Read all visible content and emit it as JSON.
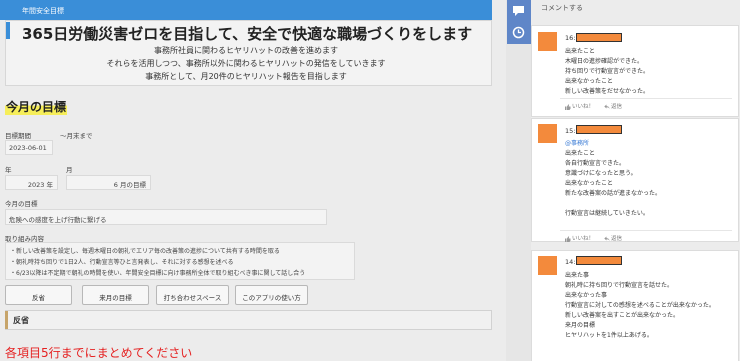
{
  "app": {
    "tab_title": "年間安全目標"
  },
  "annual_goal": {
    "headline": "365日労働災害ゼロを目指して、安全で快適な職場づくりをします",
    "lines": [
      "事務所社員に関わるヒヤリハットの改善を進めます",
      "それらを活用しつつ、事務所以外に関わるヒヤリハットの発信をしていきます",
      "事務所として、月20件のヒヤリハット報告を目指します"
    ]
  },
  "monthly": {
    "heading": "今月の目標",
    "period_label": "目標期間",
    "period_start": "2023-06-01",
    "period_end_label": "〜月末まで",
    "year_label": "年",
    "month_label": "月",
    "year_value": "2023 年",
    "month_value": "6 月の目標",
    "goal_label": "今月の目標",
    "goal_value": "危険への感度を上げ行動に繋げる",
    "actions_label": "取り組み内容",
    "actions": [
      "・新しい改善策を設定し、毎週木曜日の朝礼でエリア毎の改善策の進捗について共有する時間を取る",
      "・朝礼時持ち回りで1日2人、行動宣言等ひと言発表し、それに対する感想を述べる",
      "・6/23以降は不定期で朝礼の時間を使い、年間安全目標に向け事務所全体で取り組むべき事に関して話し合う"
    ]
  },
  "tabs": [
    "反省",
    "来月の目標",
    "打ち合わせスペース",
    "このアプリの使い方"
  ],
  "reflection": {
    "label": "反省",
    "instruction": "各項目5行までにまとめてください"
  },
  "comments_panel": {
    "header": "コメントする",
    "like_label": "いいね！",
    "reply_label": "返信",
    "comments": [
      {
        "number": "16:",
        "lines": [
          "出来たこと",
          "木曜日の進捗確認ができた。",
          "持ち回りで行動宣言ができた。",
          "出来なかったこと",
          "新しい改善策をだせなかった。"
        ]
      },
      {
        "number": "15:",
        "mention": "@事務所",
        "lines": [
          "出来たこと",
          "各自行動宣言できた。",
          "意識づけになったと思う。",
          "出来なかったこと",
          "新たな改善案の話が進まなかった。",
          "",
          "行動宣言は継続していきたい。"
        ]
      },
      {
        "number": "14:",
        "lines": [
          "出来た事",
          "朝礼時に持ち回りで行動宣言を話せた。",
          "出来なかった事",
          "行動宣言に対しての感想を述べることが出来なかった。",
          "新しい改善案を出すことが出来なかった。",
          "来月の目標",
          "ヒヤリハットを1件以上あげる。"
        ]
      }
    ]
  },
  "colors": {
    "accent_blue": "#3a8ed8",
    "avatar_orange": "#f38a3c",
    "warning_red": "#e52222",
    "highlight_yellow": "#f6ee5a"
  },
  "icons": [
    "comment-icon",
    "history-icon",
    "like-icon",
    "reply-icon"
  ]
}
